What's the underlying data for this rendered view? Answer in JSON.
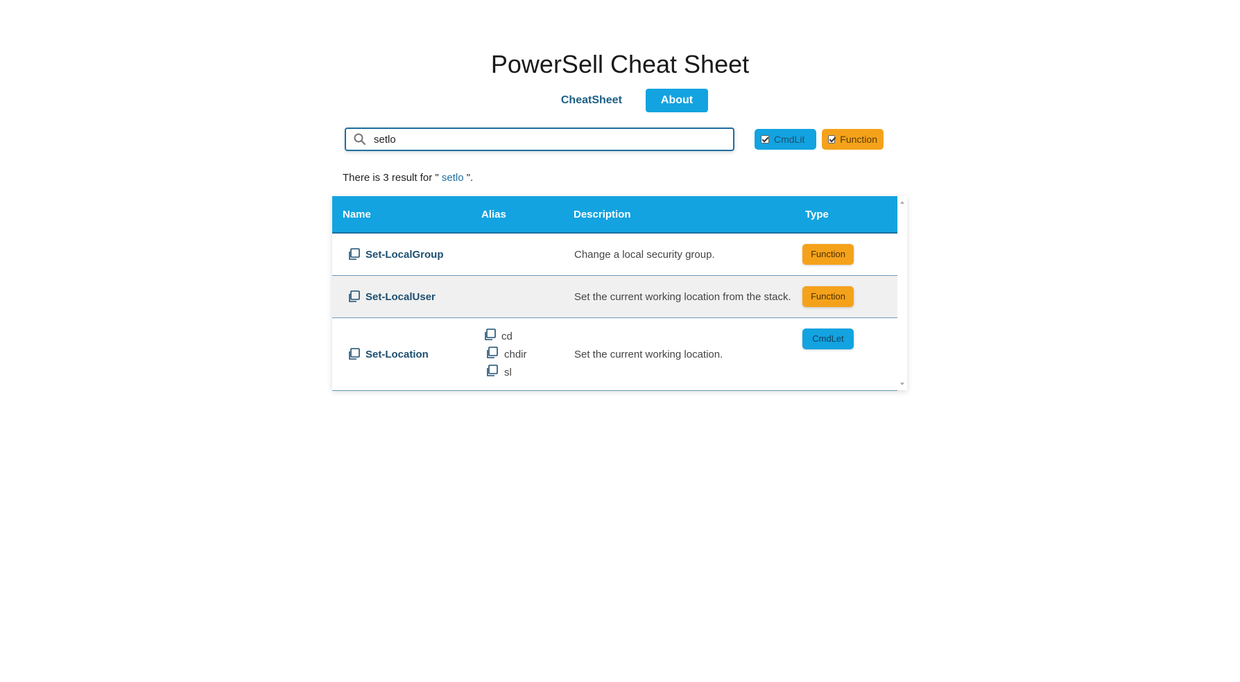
{
  "header": {
    "title": "PowerSell Cheat Sheet"
  },
  "tabs": [
    {
      "label": "CheatSheet",
      "active": false
    },
    {
      "label": "About",
      "active": true
    }
  ],
  "search": {
    "value": "setlo",
    "placeholder": ""
  },
  "filters": [
    {
      "label": "CmdLit",
      "checked": true,
      "color": "#13a3e0"
    },
    {
      "label": "Function",
      "checked": true,
      "color": "#f5a21b"
    }
  ],
  "result": {
    "prefix": "There is 3 result for \" ",
    "query": "setlo",
    "suffix": " \"."
  },
  "table": {
    "columns": [
      "Name",
      "Alias",
      "Description",
      "Type"
    ],
    "rows": [
      {
        "name": "Set-LocalGroup",
        "aliases": [],
        "description": "Change a local security group.",
        "type": "Function"
      },
      {
        "name": "Set-LocalUser",
        "aliases": [],
        "description": "Set the current working location from the stack.",
        "type": "Function"
      },
      {
        "name": "Set-Location",
        "aliases": [
          "cd",
          "chdir",
          "sl"
        ],
        "description": "Set the current working location.",
        "type": "CmdLet"
      }
    ]
  },
  "icons": {
    "copy": "copy-icon",
    "search": "search-icon",
    "check": "checkbox-icon"
  },
  "colors": {
    "accent": "#13a3e0",
    "function": "#f5a21b",
    "dark_blue": "#1d4f70"
  }
}
